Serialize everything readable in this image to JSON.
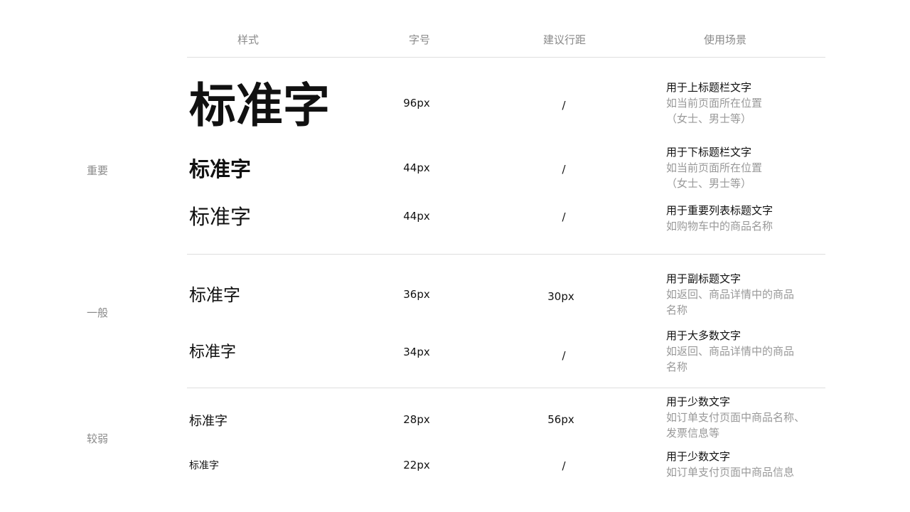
{
  "headers": {
    "style": "样式",
    "size": "字号",
    "line_height": "建议行距",
    "usage": "使用场景"
  },
  "groups": {
    "important": "重要",
    "normal": "一般",
    "weak": "较弱"
  },
  "rows": [
    {
      "sample": "标准字",
      "size": "96px",
      "line_height": "/",
      "usage": "用于上标题栏文字",
      "desc1": "如当前页面所在位置",
      "desc2": "（女士、男士等）"
    },
    {
      "sample": "标准字",
      "size": "44px",
      "line_height": "/",
      "usage": "用于下标题栏文字",
      "desc1": "如当前页面所在位置",
      "desc2": "（女士、男士等）"
    },
    {
      "sample": "标准字",
      "size": "44px",
      "line_height": "/",
      "usage": "用于重要列表标题文字",
      "desc1": "如购物车中的商品名称"
    },
    {
      "sample": "标准字",
      "size": "36px",
      "line_height": "30px",
      "usage": "用于副标题文字",
      "desc1": "如返回、商品详情中的商品",
      "desc2": "名称"
    },
    {
      "sample": "标准字",
      "size": "34px",
      "line_height": "/",
      "usage": "用于大多数文字",
      "desc1": "如返回、商品详情中的商品",
      "desc2": "名称"
    },
    {
      "sample": "标准字",
      "size": "28px",
      "line_height": "56px",
      "usage": "用于少数文字",
      "desc1": "如订单支付页面中商品名称、",
      "desc2": "发票信息等"
    },
    {
      "sample": "标准字",
      "size": "22px",
      "line_height": "/",
      "usage": "用于少数文字",
      "desc1": "如订单支付页面中商品信息"
    }
  ]
}
